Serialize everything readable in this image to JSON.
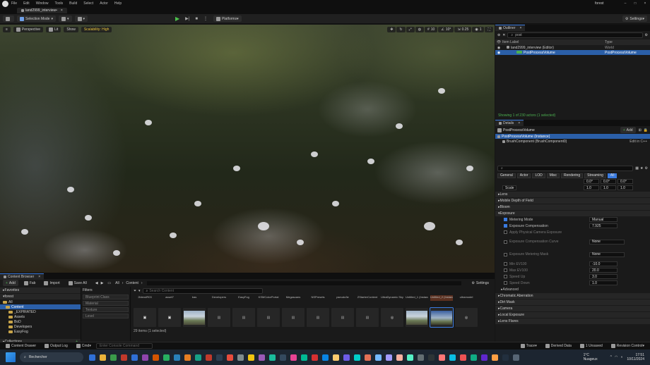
{
  "app": {
    "title": "forest",
    "tab": "land2999_interview•",
    "menu": [
      "File",
      "Edit",
      "Window",
      "Tools",
      "Build",
      "Select",
      "Actor",
      "Help"
    ]
  },
  "toolbar": {
    "selection_mode": "Selection Mode",
    "platforms": "Platforms",
    "settings": "Settings"
  },
  "viewport": {
    "perspective": "Perspective",
    "lit": "Lit",
    "show": "Show",
    "scalability": "Scalability: High",
    "grid_snap": "10",
    "rot_snap": "10°",
    "scale_snap": "0.25",
    "cam_speed": "1"
  },
  "outliner": {
    "title": "Outliner",
    "search": "post",
    "col_label": "Item Label",
    "col_type": "Type",
    "rows": [
      {
        "label": "land2999_interview (Editor)",
        "type": "World"
      },
      {
        "label": "PostProcessVolume",
        "type": "PostProcessVolume"
      }
    ],
    "status": "Showing 1 of 230 actors (1 selected)"
  },
  "details": {
    "title": "Details",
    "actor_name": "PostProcessVolume",
    "add": "Add",
    "instance": "PostProcessVolume (Instance)",
    "component": "BrushComponent (BrushComponent0)",
    "edit_cpp": "Edit in C++",
    "filter_tabs": [
      "General",
      "Actor",
      "LOD",
      "Misc",
      "Rendering",
      "Streaming",
      "All"
    ],
    "rotation": [
      "0.0°",
      "0.0°",
      "0.0°"
    ],
    "scale_label": "Scale",
    "scale": [
      "1.0",
      "1.0",
      "1.0"
    ],
    "sections": [
      "Lens",
      "Mobile Depth of Field",
      "Bloom",
      "Exposure"
    ],
    "props": {
      "metering_mode_label": "Metering Mode",
      "metering_mode": "Manual",
      "exposure_comp_label": "Exposure Compensation",
      "exposure_comp": "7.925",
      "apply_phys": "Apply Physical Camera Exposure",
      "exp_comp_curve": "Exposure Compensation Curve",
      "exp_meter_mask": "Exposure Metering Mask",
      "none1": "None",
      "none2": "None",
      "min_ev": "Min EV100",
      "min_ev_val": "-10.0",
      "max_ev": "Max EV100",
      "max_ev_val": "20.0",
      "speed_up": "Speed Up",
      "speed_up_val": "3.0",
      "speed_down": "Speed Down",
      "speed_down_val": "1.0",
      "advanced": "Advanced"
    },
    "sections2": [
      "Chromatic Aberration",
      "Dirt Mask",
      "Camera",
      "Local Exposure",
      "Lens Flares"
    ]
  },
  "content_browser": {
    "title": "Content Browser",
    "add": "Add",
    "fab": "Fab",
    "import": "Import",
    "save_all": "Save All",
    "path": [
      "All",
      "Content"
    ],
    "settings": "Settings",
    "favorites": "Favorites",
    "project": "forest",
    "tree": [
      "All",
      "Content",
      "_EXPIRATED",
      "Assets",
      "BoD",
      "Developers",
      "EasyFog"
    ],
    "collections": "Collections",
    "filters": "Filters",
    "filter_items": [
      "Blueprint Class",
      "Material",
      "Texture",
      "Level"
    ],
    "search": "Search Content",
    "assets": [
      "2blendR03",
      "asset7",
      "bas",
      "Developers",
      "EasyFog",
      "KSMColorPortal",
      "Megascans",
      "NSPresets",
      "pseudo3e",
      "ZStarterContent",
      "UltraDynamic Sky",
      "Untitled_1 (Instance)",
      "Untitled_2 (Instance)",
      "ultramodel"
    ],
    "status": "29 items (1 selected)"
  },
  "statusbar": {
    "content_drawer": "Content Drawer",
    "output_log": "Output Log",
    "cmd": "Cmd",
    "console_placeholder": "Enter Console Command",
    "trace": "Trace",
    "derived_data": "Derived Data",
    "unsaved": "1 Unsaved",
    "revision": "Revision Control"
  },
  "taskbar": {
    "search": "Rechercher",
    "weather_temp": "1°C",
    "weather_desc": "Nuageux",
    "time": "17:51",
    "date": "10/11/2024",
    "icon_colors": [
      "#2f6fd6",
      "#e8b23a",
      "#3a9a4a",
      "#c0392b",
      "#2f6fd6",
      "#8e44ad",
      "#d35400",
      "#27ae60",
      "#2980b9",
      "#e67e22",
      "#16a085",
      "#c0392b",
      "#2c3e50",
      "#e74c3c",
      "#7f8c8d",
      "#f1c40f",
      "#9b59b6",
      "#1abc9c",
      "#34495e",
      "#e84393",
      "#00b894",
      "#d63031",
      "#0984e3",
      "#fdcb6e",
      "#6c5ce7",
      "#00cec9",
      "#e17055",
      "#74b9ff",
      "#a29bfe",
      "#fab1a0",
      "#55efc4",
      "#636e72",
      "#2d3436",
      "#ff7675",
      "#0abde3",
      "#ee5253",
      "#10ac84",
      "#5f27cd",
      "#ff9f43",
      "#222f3e",
      "#576574"
    ]
  }
}
